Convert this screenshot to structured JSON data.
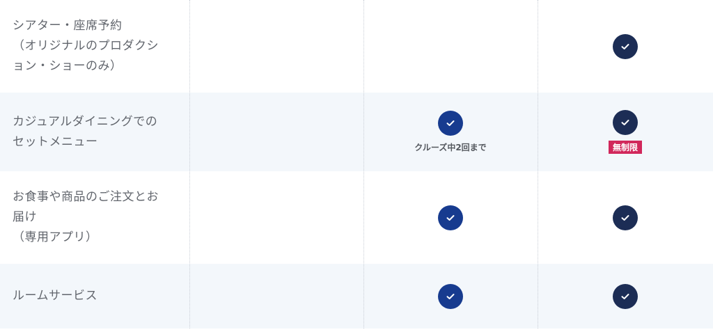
{
  "rows": [
    {
      "label": "シアター・座席予約\n（オリジナルのプロダクシ\nョン・ショーのみ）",
      "col3_check": "check-icon"
    },
    {
      "label": "カジュアルダイニングでの\nセットメニュー",
      "col2_note": "クルーズ中2回まで",
      "col3_badge": "無制限"
    },
    {
      "label": "お食事や商品のご注文とお\n届け\n（専用アプリ）"
    },
    {
      "label": "ルームサービス"
    }
  ],
  "colors": {
    "check_blue": "#173b8f",
    "check_navy": "#1c2d55",
    "badge_red": "#d1275b",
    "alt_row_bg": "#f3f7fb"
  }
}
